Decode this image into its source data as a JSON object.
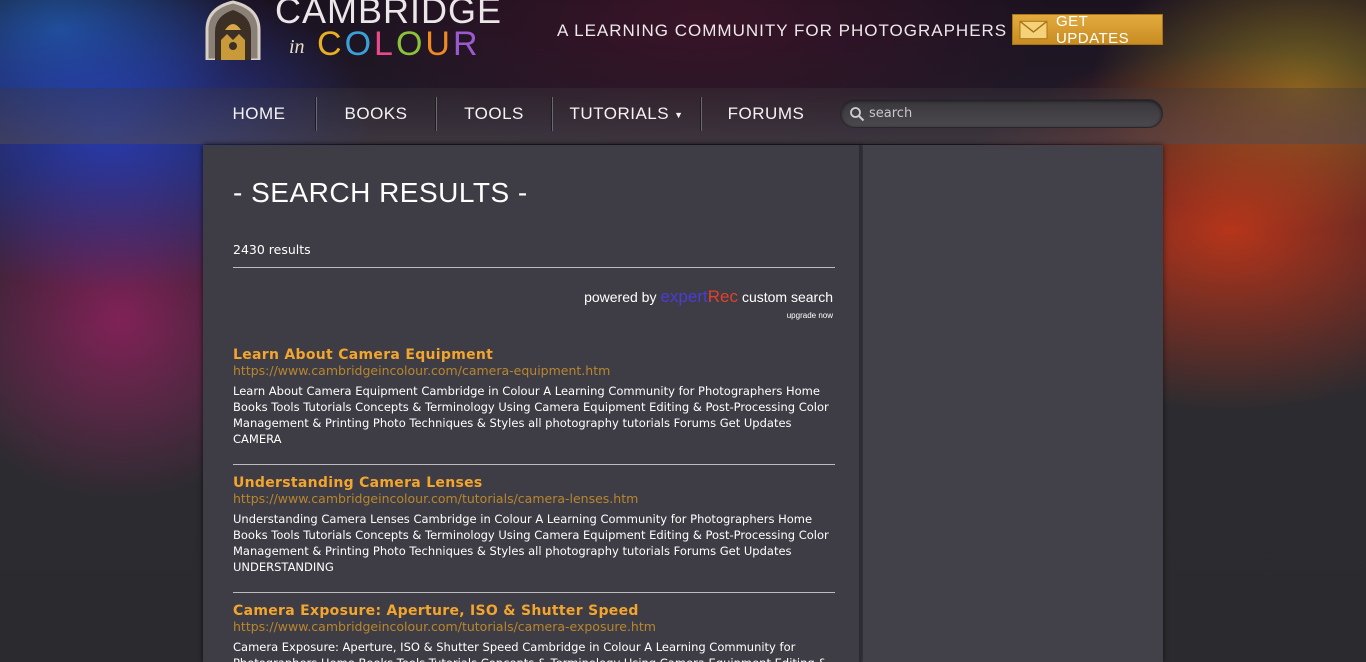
{
  "header": {
    "logo_cambridge": "CAMBRIDGE",
    "logo_in": "in",
    "logo_colour_letters": [
      "C",
      "O",
      "L",
      "O",
      "U",
      "R"
    ],
    "logo_colour_colors": [
      "#e8b020",
      "#3aa0d8",
      "#e84a8a",
      "#8ac23a",
      "#f08a20",
      "#9a5ad0"
    ],
    "tagline": "A LEARNING COMMUNITY FOR PHOTOGRAPHERS",
    "updates_label": "GET UPDATES",
    "updates_icon": "envelope-icon"
  },
  "nav": {
    "items": [
      {
        "label": "HOME"
      },
      {
        "label": "BOOKS"
      },
      {
        "label": "TOOLS"
      },
      {
        "label": "TUTORIALS",
        "has_dropdown": true
      },
      {
        "label": "FORUMS"
      }
    ],
    "search_placeholder": "search",
    "search_icon": "magnifier-icon"
  },
  "main": {
    "title": "- SEARCH RESULTS -",
    "result_count": "2430 results",
    "powered_prefix": "powered by",
    "powered_brand_a": "expert",
    "powered_brand_b": "Rec",
    "powered_suffix": "custom search",
    "upgrade": "upgrade now",
    "results": [
      {
        "title": "Learn About Camera Equipment",
        "url": "https://www.cambridgeincolour.com/camera-equipment.htm",
        "snippet": "Learn About Camera Equipment Cambridge in Colour A Learning Community for Photographers Home Books Tools Tutorials Concepts & Terminology Using Camera Equipment Editing & Post-Processing Color Management & Printing Photo Techniques & Styles all photography tutorials Forums Get Updates CAMERA"
      },
      {
        "title": "Understanding Camera Lenses",
        "url": "https://www.cambridgeincolour.com/tutorials/camera-lenses.htm",
        "snippet": "Understanding Camera Lenses Cambridge in Colour A Learning Community for Photographers Home Books Tools Tutorials Concepts & Terminology Using Camera Equipment Editing & Post-Processing Color Management & Printing Photo Techniques & Styles all photography tutorials Forums Get Updates UNDERSTANDING"
      },
      {
        "title": "Camera Exposure: Aperture, ISO & Shutter Speed",
        "url": "https://www.cambridgeincolour.com/tutorials/camera-exposure.htm",
        "snippet": "Camera Exposure: Aperture, ISO & Shutter Speed Cambridge in Colour A Learning Community for Photographers Home Books Tools Tutorials Concepts & Terminology Using Camera Equipment Editing & Post-Processing Color Management & Printing"
      }
    ]
  }
}
